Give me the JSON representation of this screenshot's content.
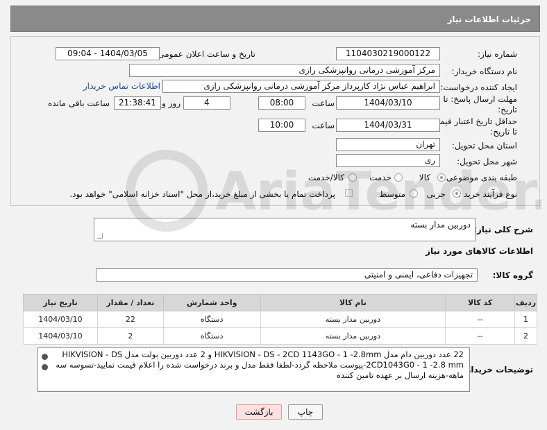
{
  "header": {
    "title": "جزئیات اطلاعات نیاز"
  },
  "fields": {
    "need_number": {
      "label": "شماره نیاز:",
      "value": "1104030219000122"
    },
    "announce": {
      "label": "تاریخ و ساعت اعلان عمومی:",
      "value": "1404/03/05 - 09:04"
    },
    "buyer": {
      "label": "نام دستگاه خریدار:",
      "value": "مرکز آموزشی درمانی روانپزشکی رازی"
    },
    "creator": {
      "label": "ایجاد کننده درخواست:",
      "value": "ابراهیم عباس نژاد کارپرداز مرکز آموزشی درمانی روانپزشکی رازی",
      "contact_link": "اطلاعات تماس خریدار"
    },
    "deadline": {
      "label_line1": "مهلت ارسال پاسخ: تا",
      "label_line2": "تاریخ:",
      "date": "1404/03/10",
      "time_label": "ساعت",
      "time": "08:00",
      "days": "4",
      "days_label": "روز و",
      "remaining": "21:38:41",
      "remaining_label": "ساعت باقی مانده"
    },
    "price_validity": {
      "label_line1": "حداقل تاریخ اعتبار قیمت:",
      "label_line2": "تا تاریخ:",
      "date": "1404/03/31",
      "time_label": "ساعت",
      "time": "10:00"
    },
    "province": {
      "label": "استان محل تحویل:",
      "value": "تهران"
    },
    "city": {
      "label": "شهر محل تحویل:",
      "value": "ری"
    },
    "category": {
      "label": "طبقه بندی موضوعی:",
      "options": [
        "کالا",
        "خدمت",
        "کالا/خدمت"
      ],
      "selected": "کالا"
    },
    "process": {
      "label": "نوع فرآیند خرید :",
      "options": [
        "جزیی",
        "متوسط"
      ],
      "selected": "جزیی",
      "payment_note": "پرداخت تمام یا بخشی از مبلغ خرید،از محل \"اسناد خزانه اسلامی\" خواهد بود."
    }
  },
  "description": {
    "label": "شرح کلی نیاز:",
    "value": "دوربین مدار بسته"
  },
  "goods_section": {
    "title": "اطلاعات کالاهای مورد نیاز"
  },
  "goods_group": {
    "label": "گروه کالا:",
    "value": "تجهیزات دفاعی، ایمنی و امنیتی"
  },
  "table": {
    "headers": [
      "ردیف",
      "کد کالا",
      "نام کالا",
      "واحد شمارش",
      "تعداد / مقدار",
      "تاریخ نیاز"
    ],
    "rows": [
      [
        "1",
        "--",
        "دوربین مدار بسته",
        "دستگاه",
        "22",
        "1404/03/10"
      ],
      [
        "2",
        "--",
        "دوربین مدار بسته",
        "دستگاه",
        "2",
        "1404/03/10"
      ]
    ]
  },
  "buyer_notes": {
    "label": "توضیحات خریدار:",
    "line1": "22 عدد دوربین دام مدل HIKVISION - DS - 2CD 1143GO - 1 -2.8mm و 2 عدد دوربین بولت مدل HIKVISION - DS",
    "line2": "2CD1043G0 - 1 -2.8 mm-پیوست ملاحظه گردد-لطفا فقط مدل و برند درخواست شده را اعلام قیمت نمایید-تسوسه سه",
    "line3": "ماهه-هزینه ارسال بر عهده تامین کننده"
  },
  "buttons": {
    "print": "چاپ",
    "back": "بازگشت"
  },
  "watermark": {
    "text": "AriaTender.neT"
  }
}
